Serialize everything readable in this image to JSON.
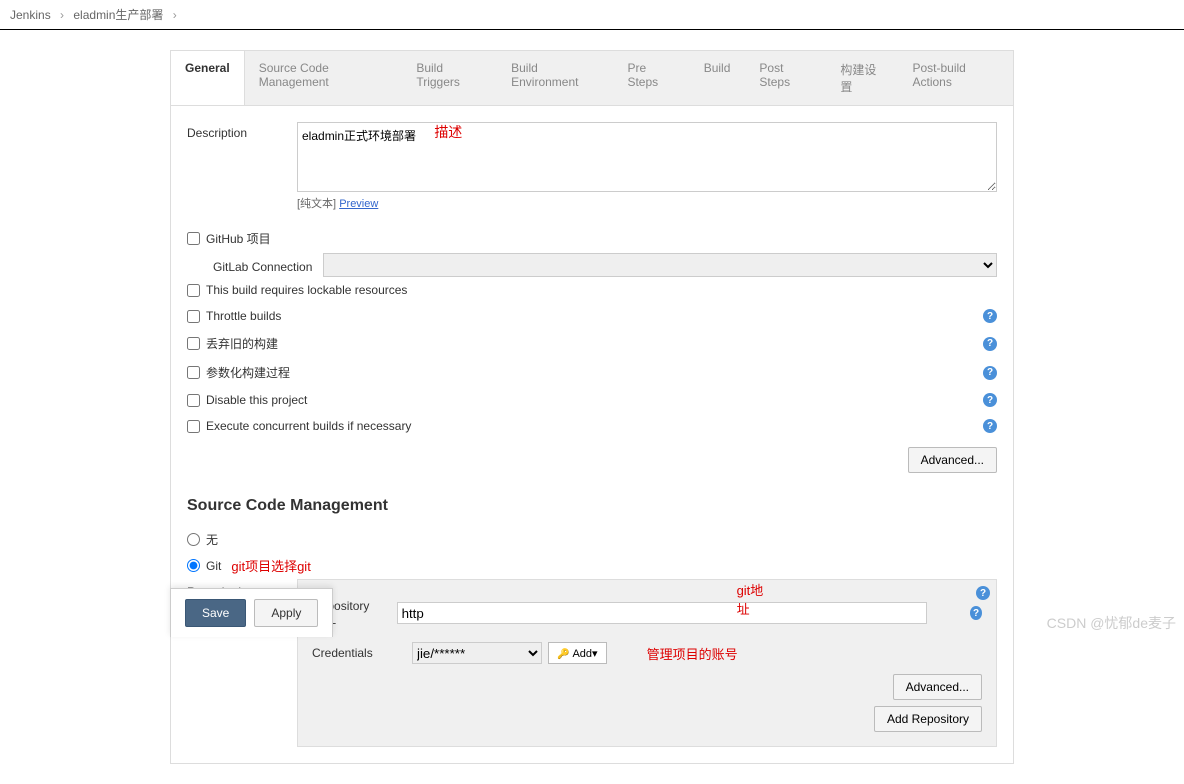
{
  "breadcrumb": {
    "jenkins": "Jenkins",
    "project": "eladmin生产部署"
  },
  "tabs": {
    "general": "General",
    "scm": "Source Code Management",
    "triggers": "Build Triggers",
    "env": "Build Environment",
    "presteps": "Pre Steps",
    "build": "Build",
    "poststeps": "Post Steps",
    "buildcfg": "构建设置",
    "postbuild": "Post-build Actions"
  },
  "general": {
    "description_label": "Description",
    "description_value": "eladmin正式环境部署",
    "description_annotation": "描述",
    "plain_text": "[纯文本]",
    "preview": "Preview",
    "github_project": "GitHub 项目",
    "gitlab_connection": "GitLab Connection",
    "lockable": "This build requires lockable resources",
    "throttle": "Throttle builds",
    "discard_old": "丢弃旧的构建",
    "parameterized": "参数化构建过程",
    "disable": "Disable this project",
    "concurrent": "Execute concurrent builds if necessary",
    "advanced": "Advanced..."
  },
  "scm_section": {
    "title": "Source Code Management",
    "none": "无",
    "git": "Git",
    "git_annotation": "git项目选择git",
    "repositories": "Repositories",
    "repo_url_label": "Repository URL",
    "repo_url_value": "http",
    "repo_url_annotation": "git地址",
    "credentials_label": "Credentials",
    "credentials_value": "jie/******",
    "add_label": "Add",
    "credentials_annotation": "管理项目的账号",
    "advanced": "Advanced...",
    "add_repo": "Add Repository"
  },
  "buttons": {
    "save": "Save",
    "apply": "Apply"
  },
  "watermark": "CSDN @忧郁de麦子"
}
